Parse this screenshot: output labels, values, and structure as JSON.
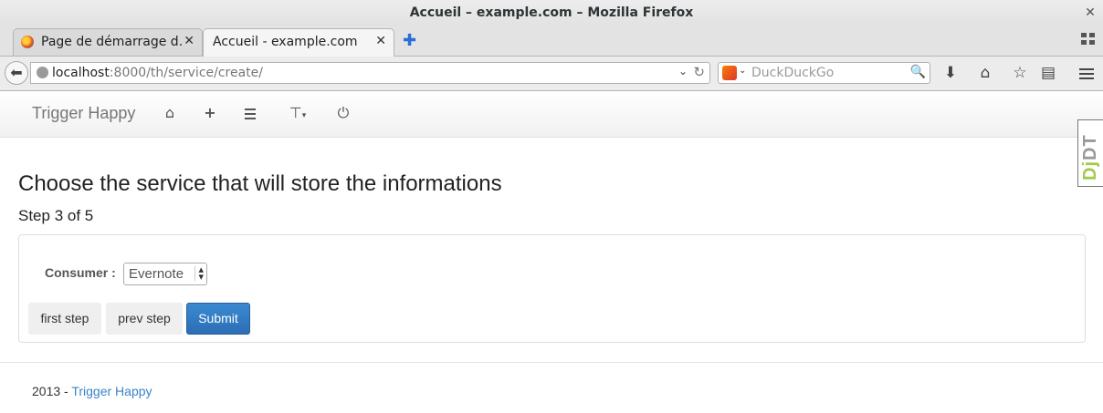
{
  "window": {
    "title": "Accueil – example.com – Mozilla Firefox"
  },
  "tabs": [
    {
      "label": "Page de démarrage d...",
      "active": false
    },
    {
      "label": "Accueil - example.com",
      "active": true
    }
  ],
  "nav": {
    "url_host": "localhost",
    "url_path": ":8000/th/service/create/",
    "search_placeholder": "DuckDuckGo"
  },
  "app": {
    "brand": "Trigger Happy",
    "nav_icons": [
      "home-icon",
      "plus-icon",
      "list-icon",
      "filter-icon",
      "power-icon"
    ],
    "debug_toolbar_label": "DjDT"
  },
  "main": {
    "title": "Choose the service that will store the informations",
    "step": "Step 3 of 5",
    "form": {
      "consumer_label": "Consumer :",
      "consumer_value": "Evernote"
    },
    "buttons": {
      "first": "first step",
      "prev": "prev step",
      "submit": "Submit"
    }
  },
  "footer": {
    "prefix": "2013 - ",
    "link": "Trigger Happy"
  },
  "colors": {
    "primary_button": "#2c6eb5",
    "link": "#3a83c8"
  }
}
